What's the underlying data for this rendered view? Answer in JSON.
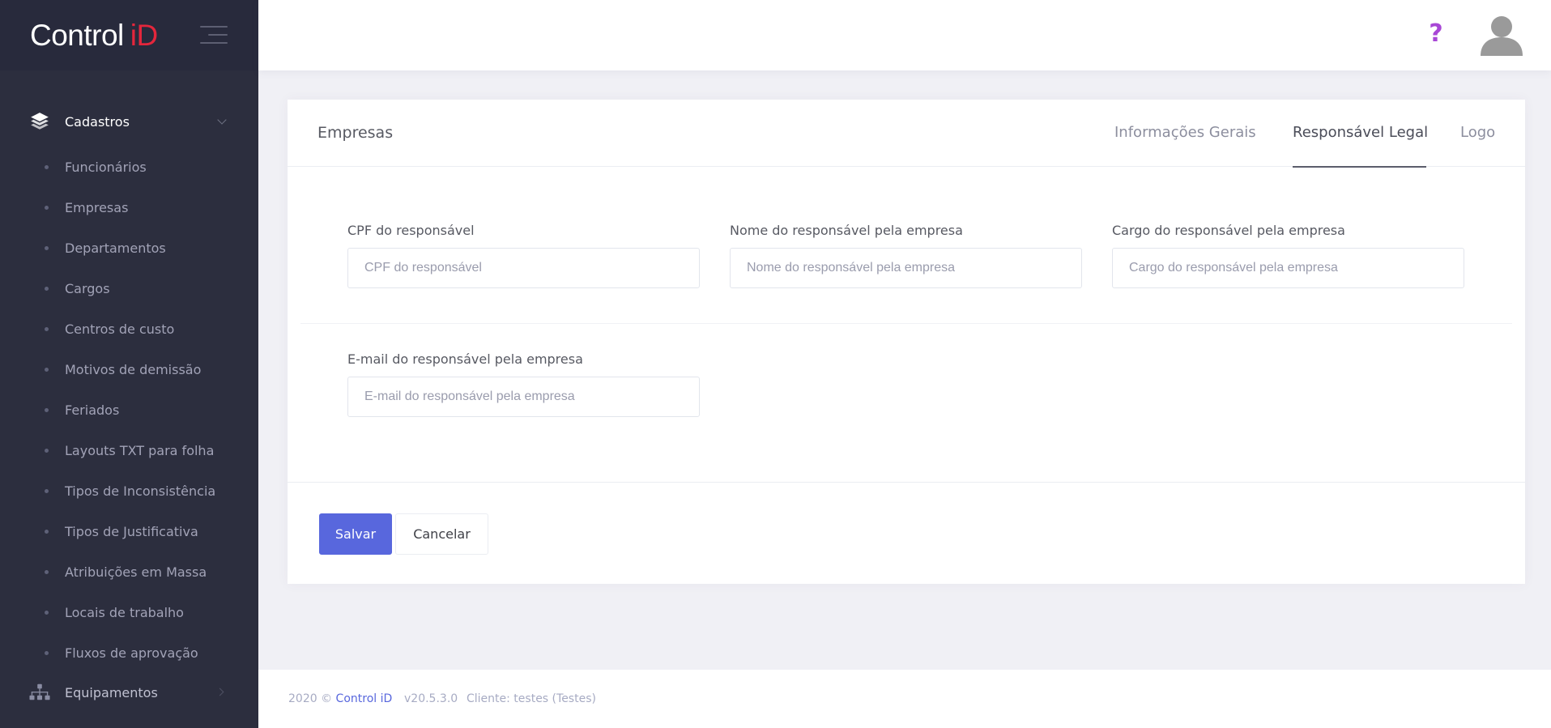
{
  "brand": {
    "logo_text": "Control",
    "logo_accent": "iD",
    "accent_color": "#e4263c"
  },
  "sidebar": {
    "section": {
      "label": "Cadastros",
      "icon": "layers-icon"
    },
    "items": [
      {
        "label": "Funcionários"
      },
      {
        "label": "Empresas"
      },
      {
        "label": "Departamentos"
      },
      {
        "label": "Cargos"
      },
      {
        "label": "Centros de custo"
      },
      {
        "label": "Motivos de demissão"
      },
      {
        "label": "Feriados"
      },
      {
        "label": "Layouts TXT para folha"
      },
      {
        "label": "Tipos de Inconsistência"
      },
      {
        "label": "Tipos de Justificativa"
      },
      {
        "label": "Atribuições em Massa"
      },
      {
        "label": "Locais de trabalho"
      },
      {
        "label": "Fluxos de aprovação"
      }
    ],
    "section2": {
      "label": "Equipamentos",
      "icon": "sitemap-icon"
    }
  },
  "header": {
    "help_icon": "?",
    "avatar_icon": "user-avatar-icon"
  },
  "card": {
    "title": "Empresas",
    "tabs": [
      {
        "label": "Informações Gerais"
      },
      {
        "label": "Responsável Legal"
      },
      {
        "label": "Logo"
      }
    ],
    "active_tab": "Responsável Legal",
    "fields": {
      "cpf": {
        "label": "CPF do responsável",
        "placeholder": "CPF do responsável",
        "value": ""
      },
      "nome": {
        "label": "Nome do responsável pela empresa",
        "placeholder": "Nome do responsável pela empresa",
        "value": ""
      },
      "cargo": {
        "label": "Cargo do responsável pela empresa",
        "placeholder": "Cargo do responsável pela empresa",
        "value": ""
      },
      "email": {
        "label": "E-mail do responsável pela empresa",
        "placeholder": "E-mail do responsável pela empresa",
        "value": ""
      }
    },
    "buttons": {
      "save": "Salvar",
      "cancel": "Cancelar"
    },
    "primary_color": "#5867dd"
  },
  "footer": {
    "copyright": "2020 ©",
    "link": "Control iD",
    "version": "v20.5.3.0",
    "client": "Cliente: testes (Testes)"
  }
}
